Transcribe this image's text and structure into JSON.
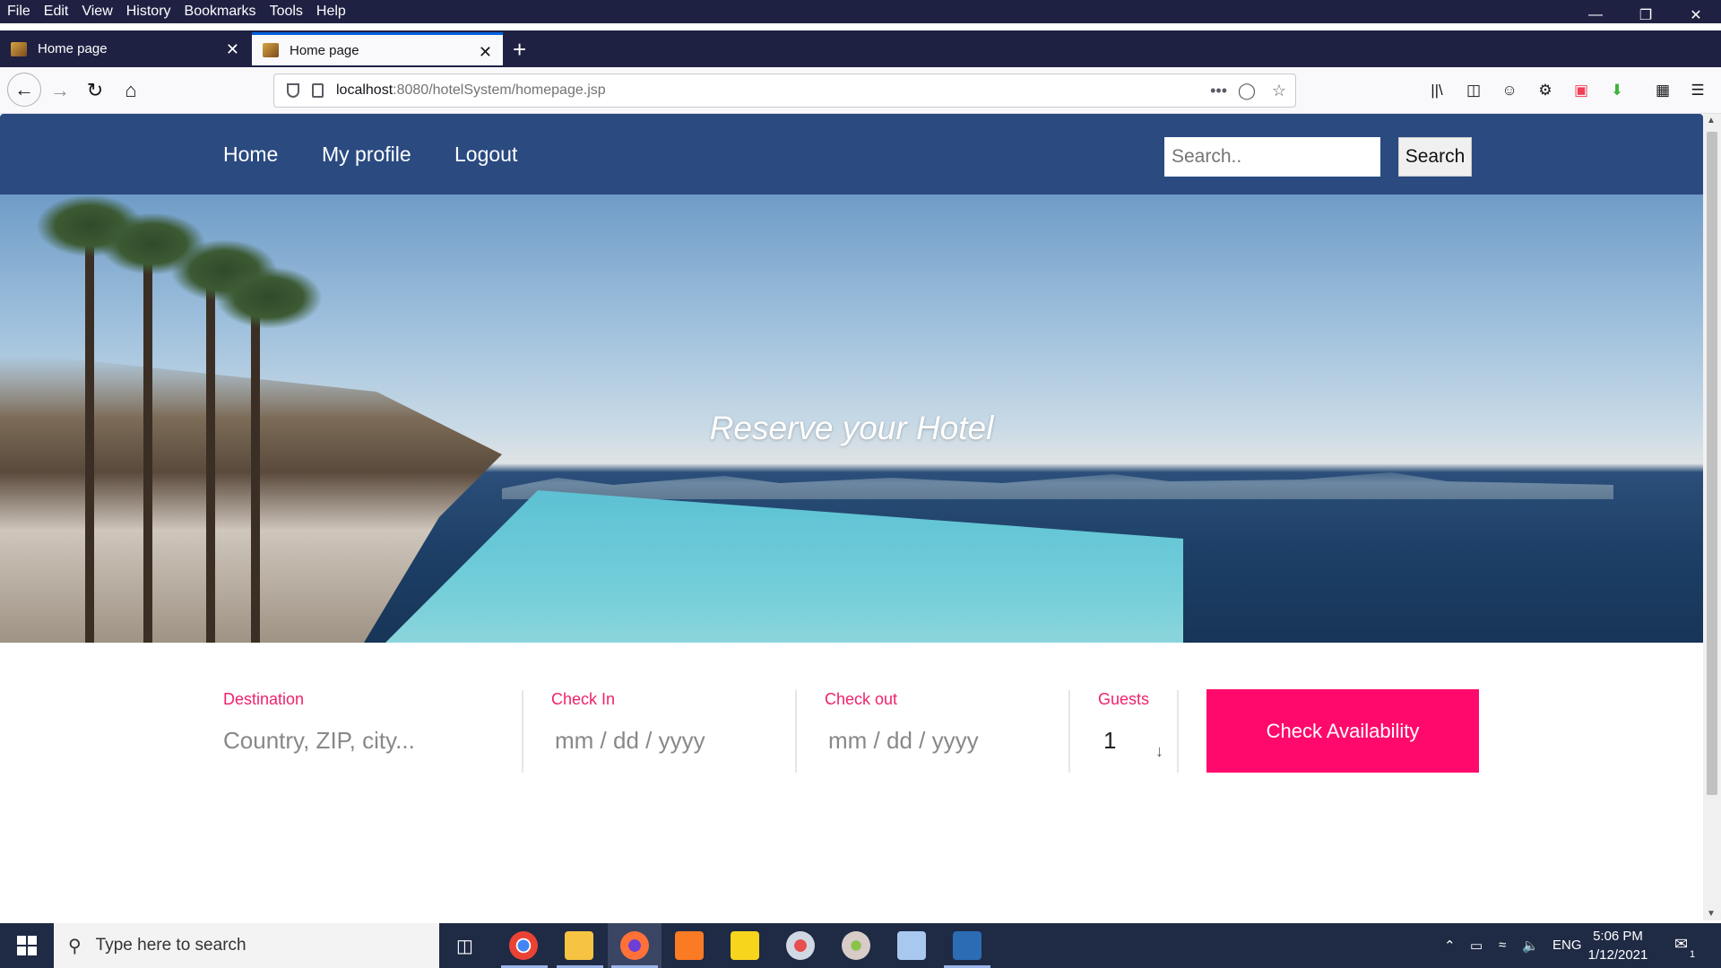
{
  "browser": {
    "menu": [
      "File",
      "Edit",
      "View",
      "History",
      "Bookmarks",
      "Tools",
      "Help"
    ],
    "tabs": [
      {
        "title": "Home page",
        "active": false
      },
      {
        "title": "Home page",
        "active": true
      }
    ],
    "url_host": "localhost",
    "url_rest": ":8080/hotelSystem/homepage.jsp"
  },
  "site": {
    "nav": {
      "home": "Home",
      "profile": "My profile",
      "logout": "Logout"
    },
    "search": {
      "placeholder": "Search..",
      "button": "Search"
    },
    "hero_title": "Reserve your Hotel",
    "booking": {
      "destination_label": "Destination",
      "destination_placeholder": "Country, ZIP, city...",
      "checkin_label": "Check In",
      "checkin_value": "mm / dd / yyyy",
      "checkout_label": "Check out",
      "checkout_value": "mm / dd / yyyy",
      "guests_label": "Guests",
      "guests_value": "1",
      "submit": "Check Availability"
    },
    "accent_color": "#ff0a6c",
    "header_color": "#2a4a80"
  },
  "taskbar": {
    "search_placeholder": "Type here to search",
    "lang": "ENG",
    "time": "5:06 PM",
    "date": "1/12/2021",
    "notifications": "1"
  }
}
